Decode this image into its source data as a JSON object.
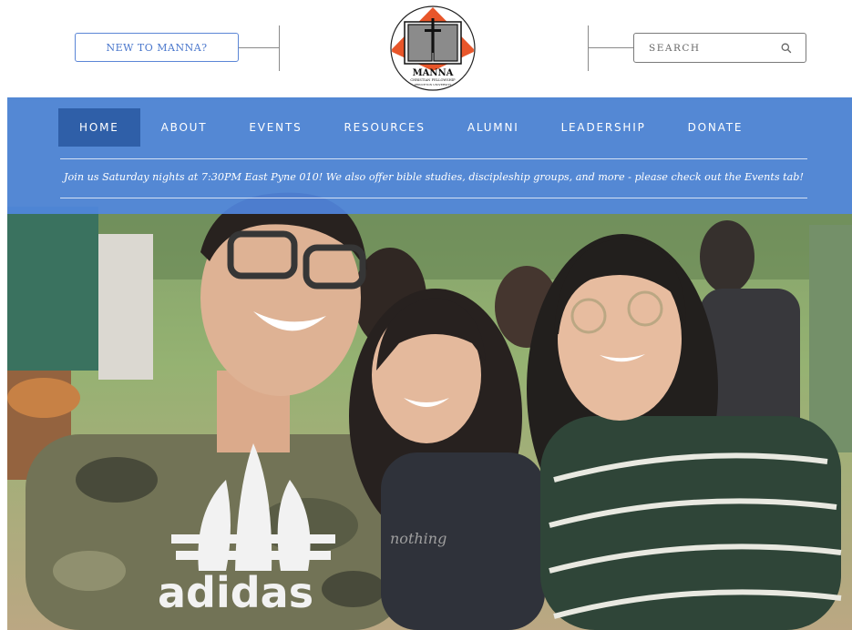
{
  "header": {
    "new_button_label": "NEW TO MANNA?",
    "search_placeholder": "SEARCH",
    "logo": {
      "title": "MANNA",
      "line2": "CHRISTIAN FELLOWSHIP",
      "line3": "PRINCETON UNIVERSITY"
    }
  },
  "nav": {
    "items": [
      {
        "label": "HOME",
        "active": true
      },
      {
        "label": "ABOUT",
        "active": false
      },
      {
        "label": "EVENTS",
        "active": false
      },
      {
        "label": "RESOURCES",
        "active": false
      },
      {
        "label": "ALUMNI",
        "active": false
      },
      {
        "label": "LEADERSHIP",
        "active": false
      },
      {
        "label": "DONATE",
        "active": false
      }
    ]
  },
  "announcement": "Join us Saturday nights at 7:30PM East Pyne 010! We also offer bible studies, discipleship groups, and more - please check out the Events tab!",
  "hero": {
    "shirt_text": "adidas",
    "shirt2_text": "nothing"
  },
  "colors": {
    "accent": "#4a77cc",
    "nav_band": "#5187e1",
    "nav_active": "#2f5fa8",
    "logo_orange": "#e8562a"
  }
}
